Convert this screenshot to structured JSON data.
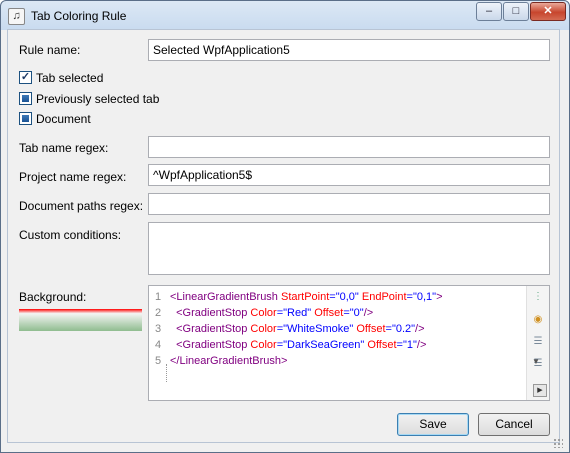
{
  "window": {
    "title": "Tab Coloring Rule",
    "minimize_glyph": "–",
    "maximize_glyph": "□",
    "close_glyph": "✕"
  },
  "form": {
    "rule_name_label": "Rule name:",
    "rule_name_value": "Selected WpfApplication5",
    "checkboxes": [
      {
        "label": "Tab selected",
        "state": "checked"
      },
      {
        "label": "Previously selected tab",
        "state": "indeterminate"
      },
      {
        "label": "Document",
        "state": "indeterminate"
      }
    ],
    "tab_name_regex_label": "Tab name regex:",
    "tab_name_regex_value": "",
    "project_name_regex_label": "Project name regex:",
    "project_name_regex_value": "^WpfApplication5$",
    "document_paths_regex_label": "Document paths regex:",
    "document_paths_regex_value": "",
    "custom_conditions_label": "Custom conditions:",
    "custom_conditions_value": "",
    "background_label": "Background:"
  },
  "background_gradient": {
    "stops": [
      {
        "color": "#ff0000",
        "offset": "0"
      },
      {
        "color": "#f5f5f5",
        "offset": "0.2"
      },
      {
        "color": "#8fbc8f",
        "offset": "1"
      }
    ]
  },
  "editor": {
    "line_numbers": [
      "1",
      "2",
      "3",
      "4",
      "5"
    ],
    "lines": [
      {
        "indent": "",
        "tag": "<LinearGradientBrush",
        "a1": " StartPoint",
        "v1": "=\"0,0\"",
        "a2": " EndPoint",
        "v2": "=\"0,1\"",
        "end": ">"
      },
      {
        "indent": "  ",
        "tag": "<GradientStop",
        "a1": " Color",
        "v1": "=\"Red\"",
        "a2": " Offset",
        "v2": "=\"0\"",
        "end": "/>"
      },
      {
        "indent": "  ",
        "tag": "<GradientStop",
        "a1": " Color",
        "v1": "=\"WhiteSmoke\"",
        "a2": " Offset",
        "v2": "=\"0.2\"",
        "end": "/>"
      },
      {
        "indent": "  ",
        "tag": "<GradientStop",
        "a1": " Color",
        "v1": "=\"DarkSeaGreen\"",
        "a2": " Offset",
        "v2": "=\"1\"",
        "end": "/>"
      },
      {
        "indent": "",
        "tag": "</LinearGradientBrush>",
        "a1": "",
        "v1": "",
        "a2": "",
        "v2": "",
        "end": ""
      }
    ]
  },
  "buttons": {
    "save": "Save",
    "cancel": "Cancel"
  }
}
